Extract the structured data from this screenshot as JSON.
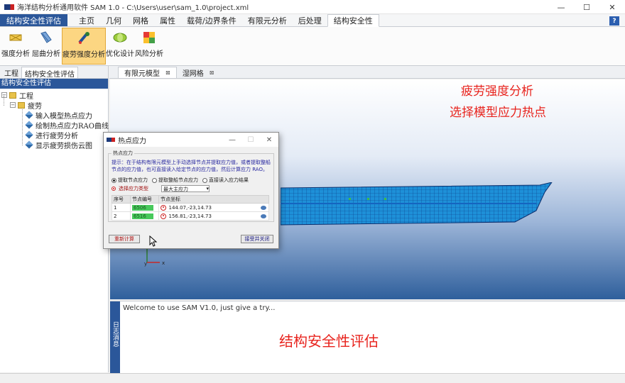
{
  "window": {
    "title": "海洋结构分析通用软件 SAM 1.0 - C:\\Users\\user\\sam_1.0\\project.xml",
    "minimize": "—",
    "maximize": "☐",
    "close": "✕"
  },
  "ribbon": {
    "file_tab": "结构安全性评估",
    "tabs": [
      "主页",
      "几何",
      "网格",
      "属性",
      "载荷/边界条件",
      "有限元分析",
      "后处理",
      "结构安全性"
    ],
    "active_tab": "结构安全性",
    "help_label": "?",
    "buttons": [
      {
        "label": "强度分析",
        "icon": "strength-analysis-icon"
      },
      {
        "label": "屈曲分析",
        "icon": "buckling-analysis-icon"
      },
      {
        "label": "疲劳强度分析",
        "icon": "fatigue-analysis-icon",
        "active": true
      },
      {
        "label": "优化设计",
        "icon": "optimization-icon"
      },
      {
        "label": "风险分析",
        "icon": "risk-analysis-icon"
      }
    ]
  },
  "left_panel": {
    "tabs": [
      "工程",
      "结构安全性评估"
    ],
    "active_tab": "结构安全性评估",
    "header": "结构安全性评估",
    "tree": {
      "root": "工程",
      "node": "疲劳",
      "items": [
        "输入模型热点应力",
        "绘制热点应力RAO曲线",
        "进行疲劳分析",
        "显示疲劳损伤云图"
      ]
    }
  },
  "doc_tabs": [
    {
      "label": "有限元模型",
      "close": "⊠"
    },
    {
      "label": "湿网格",
      "close": "⊠"
    }
  ],
  "viewport": {
    "annotation_line1": "疲劳强度分析",
    "annotation_line2": "选择模型应力热点",
    "axis_y": "y",
    "axis_x": "x"
  },
  "output": {
    "side_label": "日志消息",
    "text": "Welcome to use SAM V1.0, just give a try...",
    "annotation": "结构安全性评估"
  },
  "dialog": {
    "title": "热点应力",
    "group_title": "热点应力",
    "hint": "提示：在于结构有限元模型上手动选择节点并提取应力值，或者提取整船节点的应力值，也可直接读入给定节点的应力值，然后计算应力 RAO。",
    "radios": [
      "提取节点应力",
      "提取整船节点应力",
      "直接读入应力结果"
    ],
    "stress_type_label": "选择应力类型",
    "stress_type_value": "最大主应力",
    "columns": [
      "序号",
      "节点编号",
      "节点坐标"
    ],
    "rows": [
      {
        "index": "1",
        "node": "6506",
        "coord": "144.07,-23,14.73"
      },
      {
        "index": "2",
        "node": "6516",
        "coord": "156.81,-23,14.73"
      }
    ],
    "calc_button": "重新计算",
    "ok_button": "接受并关闭"
  },
  "colors": {
    "accent": "#2b579a",
    "annotation_red": "#e8231d",
    "node_green": "#47c95b",
    "ribbon_active": "#fcd682"
  }
}
